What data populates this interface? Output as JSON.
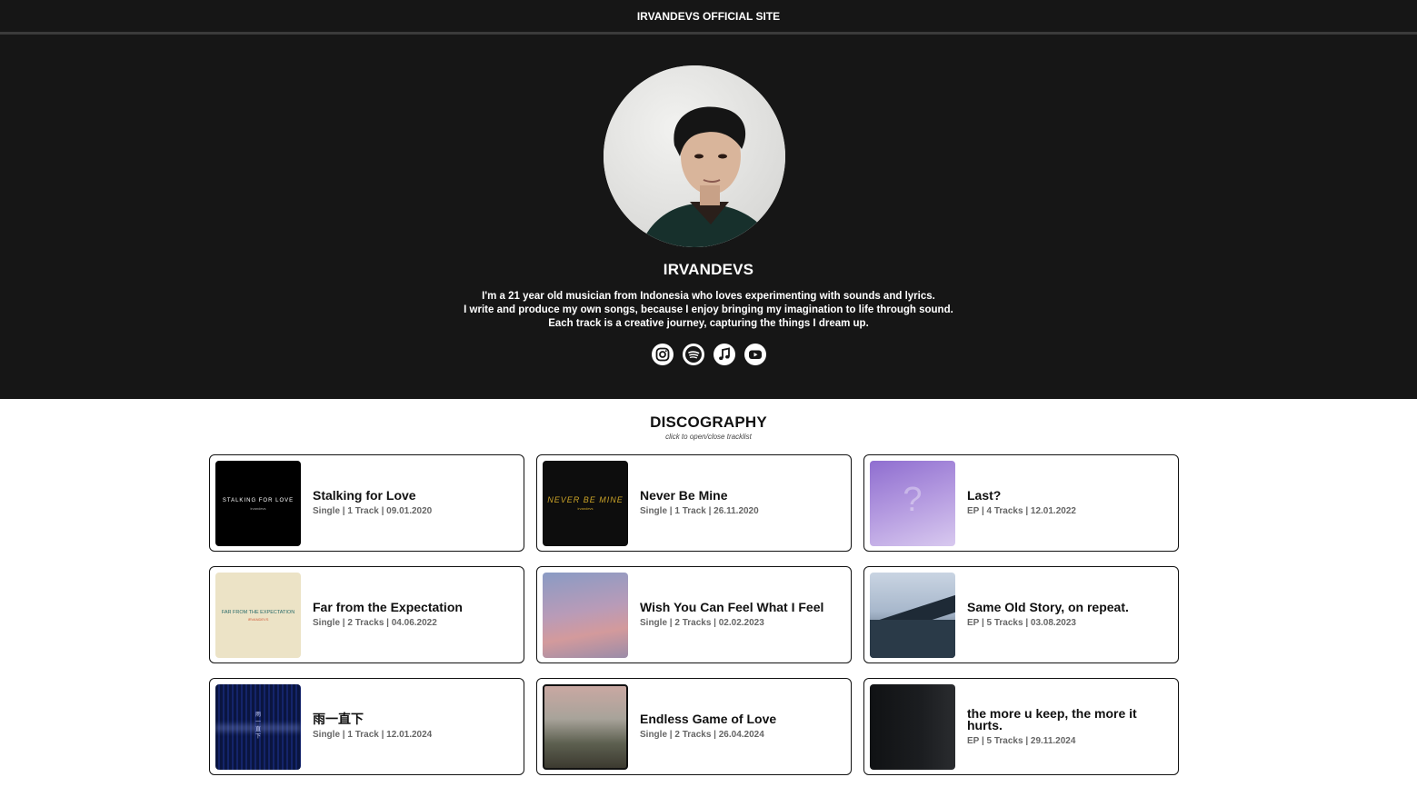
{
  "header": {
    "site_title": "IRVANDEVS OFFICIAL SITE"
  },
  "profile": {
    "name": "IRVANDEVS",
    "bio": [
      "I'm a 21 year old musician from Indonesia who loves experimenting with sounds and lyrics.",
      "I write and produce my own songs, because I enjoy bringing my imagination to life through sound.",
      "Each track is a creative journey, capturing the things I dream up."
    ],
    "socials": [
      "instagram-icon",
      "spotify-icon",
      "apple-music-icon",
      "youtube-icon"
    ]
  },
  "discography": {
    "title": "DISCOGRAPHY",
    "hint": "click to open/close tracklist",
    "releases": [
      {
        "title": "Stalking for Love",
        "meta": "Single | 1 Track | 09.01.2020",
        "cover_text": "STALKING FOR LOVE",
        "cover_subtext": "irvandevs"
      },
      {
        "title": "Never Be Mine",
        "meta": "Single | 1 Track | 26.11.2020",
        "cover_text": "NEVER BE MINE",
        "cover_subtext": "irvandevs"
      },
      {
        "title": "Last?",
        "meta": "EP | 4 Tracks | 12.01.2022",
        "cover_text": "?",
        "cover_subtext": ""
      },
      {
        "title": "Far from the Expectation",
        "meta": "Single | 2 Tracks | 04.06.2022",
        "cover_text": "FAR FROM THE EXPECTATION",
        "cover_subtext": "IRVANDEVS"
      },
      {
        "title": "Wish You Can Feel What I Feel",
        "meta": "Single | 2 Tracks | 02.02.2023",
        "cover_text": "",
        "cover_subtext": ""
      },
      {
        "title": "Same Old Story, on repeat.",
        "meta": "EP | 5 Tracks | 03.08.2023",
        "cover_text": "",
        "cover_subtext": ""
      },
      {
        "title": "雨一直下",
        "meta": "Single | 1 Track | 12.01.2024",
        "cover_text": "雨一直下",
        "cover_subtext": ""
      },
      {
        "title": "Endless Game of Love",
        "meta": "Single | 2 Tracks | 26.04.2024",
        "cover_text": "",
        "cover_subtext": ""
      },
      {
        "title": "the more u keep, the more it hurts.",
        "meta": "EP | 5 Tracks | 29.11.2024",
        "cover_text": "",
        "cover_subtext": ""
      }
    ]
  },
  "colors": {
    "header_bg": "#161616",
    "card_border": "#111111",
    "meta_text": "#666666"
  }
}
